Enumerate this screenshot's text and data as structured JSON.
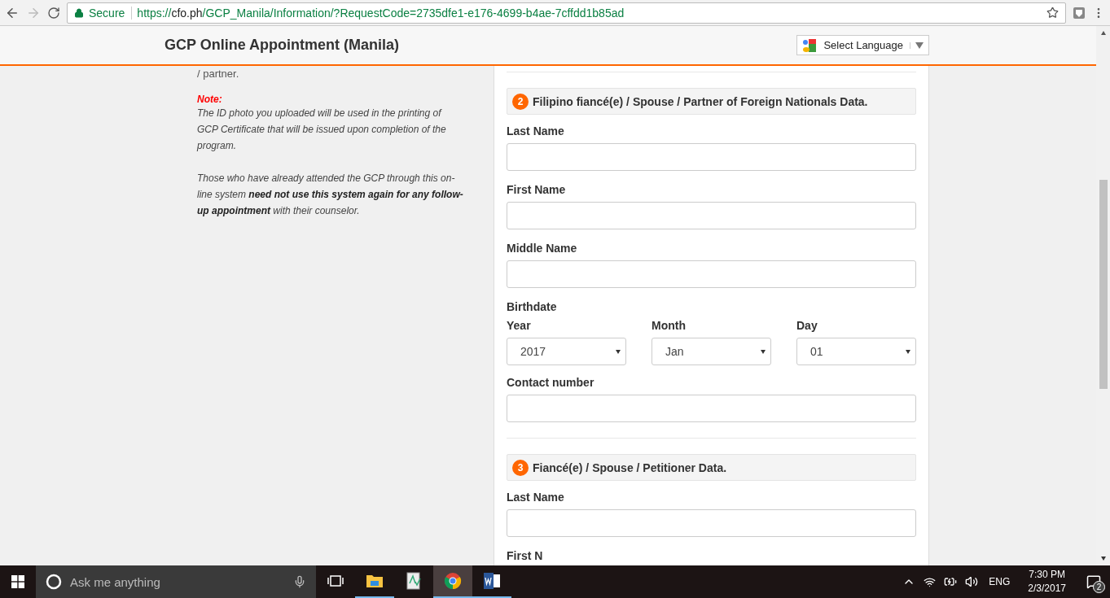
{
  "browser": {
    "secure_label": "Secure",
    "url_scheme": "https://",
    "url_host": "cfo.ph",
    "url_path": "/GCP_Manila/Information/?RequestCode=2735dfe1-e176-4699-b4ae-7cffdd1b85ad"
  },
  "header": {
    "title": "GCP Online Appointment (Manila)",
    "language_button": "Select Language"
  },
  "side_notes": {
    "fragment": "/ partner.",
    "note_label": "Note:",
    "paragraphs": [
      "The ID photo you uploaded will be used in the printing of GCP Certificate that will be issued upon completion of the program.",
      "Those who have already attended the GCP through this on-line system **need not use this system again for any follow-up appointment** with their counselor."
    ]
  },
  "sections": [
    {
      "number": "2",
      "title": "Filipino fiancé(e) / Spouse / Partner of Foreign Nationals Data.",
      "fields": [
        {
          "kind": "text",
          "label": "Last Name"
        },
        {
          "kind": "text",
          "label": "First Name"
        },
        {
          "kind": "text",
          "label": "Middle Name"
        },
        {
          "kind": "date",
          "label": "Birthdate",
          "selects": [
            {
              "label": "Year",
              "value": "2017"
            },
            {
              "label": "Month",
              "value": "Jan"
            },
            {
              "label": "Day",
              "value": "01"
            }
          ]
        },
        {
          "kind": "text",
          "label": "Contact number"
        }
      ]
    },
    {
      "number": "3",
      "title": "Fiancé(e) / Spouse / Petitioner Data.",
      "fields": [
        {
          "kind": "text",
          "label": "Last Name"
        },
        {
          "kind": "label",
          "label": "First N"
        }
      ]
    }
  ],
  "taskbar": {
    "search_placeholder": "Ask me anything",
    "apps": [
      {
        "kind": "explorer",
        "running": true,
        "selected": false
      },
      {
        "kind": "notepad",
        "running": false,
        "selected": false
      },
      {
        "kind": "chrome",
        "running": true,
        "selected": true
      },
      {
        "kind": "word",
        "running": true,
        "selected": false
      }
    ],
    "language": "ENG",
    "time": "7:30 PM",
    "date": "2/3/2017",
    "notifications": "2"
  }
}
